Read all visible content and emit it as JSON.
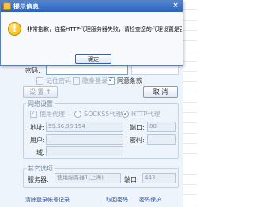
{
  "alert": {
    "title": "提示信息",
    "close_glyph": "×",
    "warning_glyph": "!",
    "message": "非常抱歉，连接HTTP代理服务器失败，请检查您的代理设置是否正确!",
    "ok_label": "确定"
  },
  "login": {
    "password_label": "密码:",
    "remember_password": "记住密码",
    "invisible_login": "隐身登录",
    "agree_terms": "同意条款",
    "settings_button": "设 置 ↑",
    "cancel_button": "取 消",
    "network_group_title": "网络设置",
    "use_proxy": "使用代理",
    "socks5_proxy": "SOCKS5代理",
    "http_proxy": "HTTP代理",
    "address_label": "地址:",
    "address_value": "59.36.98.154",
    "port_label": "端口:",
    "port_value": "80",
    "user_label": "用户:",
    "pwd_label": "密码:",
    "domain_label": "域:",
    "other_group_title": "其它选项",
    "server_label": "服务器:",
    "server_value": "使用服务器1(上海)",
    "port2_label": "端口:",
    "port2_value": "443",
    "clear_records": "清除登录帐号记录",
    "retrieve_password": "取回密码",
    "password_protect": "密码保护"
  }
}
